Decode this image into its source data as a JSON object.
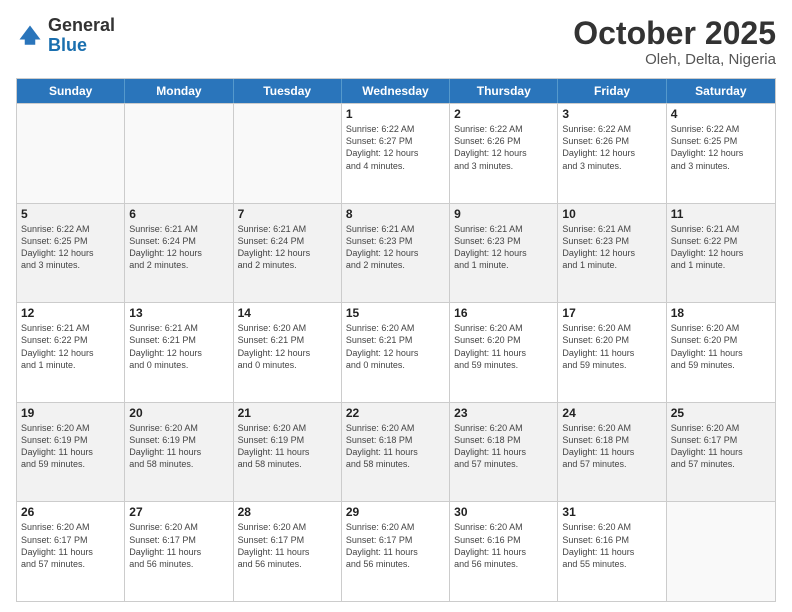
{
  "logo": {
    "general": "General",
    "blue": "Blue"
  },
  "title": "October 2025",
  "location": "Oleh, Delta, Nigeria",
  "days_of_week": [
    "Sunday",
    "Monday",
    "Tuesday",
    "Wednesday",
    "Thursday",
    "Friday",
    "Saturday"
  ],
  "weeks": [
    [
      {
        "day": "",
        "info": ""
      },
      {
        "day": "",
        "info": ""
      },
      {
        "day": "",
        "info": ""
      },
      {
        "day": "1",
        "info": "Sunrise: 6:22 AM\nSunset: 6:27 PM\nDaylight: 12 hours\nand 4 minutes."
      },
      {
        "day": "2",
        "info": "Sunrise: 6:22 AM\nSunset: 6:26 PM\nDaylight: 12 hours\nand 3 minutes."
      },
      {
        "day": "3",
        "info": "Sunrise: 6:22 AM\nSunset: 6:26 PM\nDaylight: 12 hours\nand 3 minutes."
      },
      {
        "day": "4",
        "info": "Sunrise: 6:22 AM\nSunset: 6:25 PM\nDaylight: 12 hours\nand 3 minutes."
      }
    ],
    [
      {
        "day": "5",
        "info": "Sunrise: 6:22 AM\nSunset: 6:25 PM\nDaylight: 12 hours\nand 3 minutes."
      },
      {
        "day": "6",
        "info": "Sunrise: 6:21 AM\nSunset: 6:24 PM\nDaylight: 12 hours\nand 2 minutes."
      },
      {
        "day": "7",
        "info": "Sunrise: 6:21 AM\nSunset: 6:24 PM\nDaylight: 12 hours\nand 2 minutes."
      },
      {
        "day": "8",
        "info": "Sunrise: 6:21 AM\nSunset: 6:23 PM\nDaylight: 12 hours\nand 2 minutes."
      },
      {
        "day": "9",
        "info": "Sunrise: 6:21 AM\nSunset: 6:23 PM\nDaylight: 12 hours\nand 1 minute."
      },
      {
        "day": "10",
        "info": "Sunrise: 6:21 AM\nSunset: 6:23 PM\nDaylight: 12 hours\nand 1 minute."
      },
      {
        "day": "11",
        "info": "Sunrise: 6:21 AM\nSunset: 6:22 PM\nDaylight: 12 hours\nand 1 minute."
      }
    ],
    [
      {
        "day": "12",
        "info": "Sunrise: 6:21 AM\nSunset: 6:22 PM\nDaylight: 12 hours\nand 1 minute."
      },
      {
        "day": "13",
        "info": "Sunrise: 6:21 AM\nSunset: 6:21 PM\nDaylight: 12 hours\nand 0 minutes."
      },
      {
        "day": "14",
        "info": "Sunrise: 6:20 AM\nSunset: 6:21 PM\nDaylight: 12 hours\nand 0 minutes."
      },
      {
        "day": "15",
        "info": "Sunrise: 6:20 AM\nSunset: 6:21 PM\nDaylight: 12 hours\nand 0 minutes."
      },
      {
        "day": "16",
        "info": "Sunrise: 6:20 AM\nSunset: 6:20 PM\nDaylight: 11 hours\nand 59 minutes."
      },
      {
        "day": "17",
        "info": "Sunrise: 6:20 AM\nSunset: 6:20 PM\nDaylight: 11 hours\nand 59 minutes."
      },
      {
        "day": "18",
        "info": "Sunrise: 6:20 AM\nSunset: 6:20 PM\nDaylight: 11 hours\nand 59 minutes."
      }
    ],
    [
      {
        "day": "19",
        "info": "Sunrise: 6:20 AM\nSunset: 6:19 PM\nDaylight: 11 hours\nand 59 minutes."
      },
      {
        "day": "20",
        "info": "Sunrise: 6:20 AM\nSunset: 6:19 PM\nDaylight: 11 hours\nand 58 minutes."
      },
      {
        "day": "21",
        "info": "Sunrise: 6:20 AM\nSunset: 6:19 PM\nDaylight: 11 hours\nand 58 minutes."
      },
      {
        "day": "22",
        "info": "Sunrise: 6:20 AM\nSunset: 6:18 PM\nDaylight: 11 hours\nand 58 minutes."
      },
      {
        "day": "23",
        "info": "Sunrise: 6:20 AM\nSunset: 6:18 PM\nDaylight: 11 hours\nand 57 minutes."
      },
      {
        "day": "24",
        "info": "Sunrise: 6:20 AM\nSunset: 6:18 PM\nDaylight: 11 hours\nand 57 minutes."
      },
      {
        "day": "25",
        "info": "Sunrise: 6:20 AM\nSunset: 6:17 PM\nDaylight: 11 hours\nand 57 minutes."
      }
    ],
    [
      {
        "day": "26",
        "info": "Sunrise: 6:20 AM\nSunset: 6:17 PM\nDaylight: 11 hours\nand 57 minutes."
      },
      {
        "day": "27",
        "info": "Sunrise: 6:20 AM\nSunset: 6:17 PM\nDaylight: 11 hours\nand 56 minutes."
      },
      {
        "day": "28",
        "info": "Sunrise: 6:20 AM\nSunset: 6:17 PM\nDaylight: 11 hours\nand 56 minutes."
      },
      {
        "day": "29",
        "info": "Sunrise: 6:20 AM\nSunset: 6:17 PM\nDaylight: 11 hours\nand 56 minutes."
      },
      {
        "day": "30",
        "info": "Sunrise: 6:20 AM\nSunset: 6:16 PM\nDaylight: 11 hours\nand 56 minutes."
      },
      {
        "day": "31",
        "info": "Sunrise: 6:20 AM\nSunset: 6:16 PM\nDaylight: 11 hours\nand 55 minutes."
      },
      {
        "day": "",
        "info": ""
      }
    ]
  ]
}
